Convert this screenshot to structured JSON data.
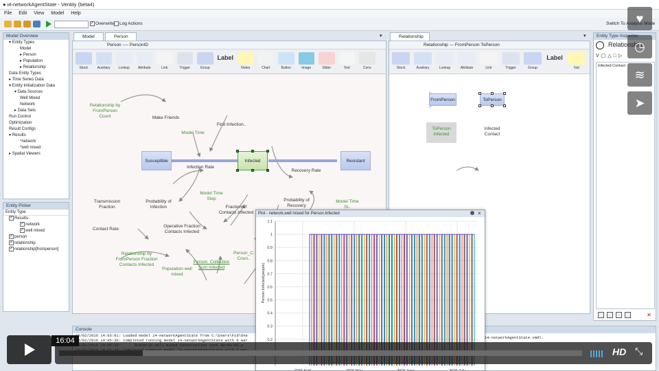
{
  "window": {
    "title": "● i4-networkAgentState - Ventity (beta4)",
    "switch_label": "Switch To Analysis Mode"
  },
  "menu": [
    "File",
    "Edit",
    "View",
    "Model",
    "Help"
  ],
  "toolbar": {
    "overwrite_label": "Overwrite",
    "log_label": "Log Actions",
    "overwrite_checked": true
  },
  "model_overview": {
    "title": "Model Overview",
    "items": [
      {
        "label": "Entity Types",
        "indent": 1,
        "toggle": "▾"
      },
      {
        "label": "Model",
        "indent": 3,
        "toggle": ""
      },
      {
        "label": "Person",
        "indent": 3,
        "toggle": "▸"
      },
      {
        "label": "Population",
        "indent": 3,
        "toggle": "▸"
      },
      {
        "label": "Relationship",
        "indent": 3,
        "toggle": "▸"
      },
      {
        "label": "Data Entity Types",
        "indent": 1,
        "toggle": ""
      },
      {
        "label": "Time Series Data",
        "indent": 1,
        "toggle": "▸"
      },
      {
        "label": "Entity Initialization Data",
        "indent": 1,
        "toggle": "▾"
      },
      {
        "label": "Data Sources",
        "indent": 2,
        "toggle": "▾"
      },
      {
        "label": "Well Mixed",
        "indent": 3,
        "toggle": ""
      },
      {
        "label": "Network",
        "indent": 3,
        "toggle": ""
      },
      {
        "label": "Data Sets",
        "indent": 2,
        "toggle": "▸"
      },
      {
        "label": "Run Control",
        "indent": 1,
        "toggle": ""
      },
      {
        "label": "Optimization",
        "indent": 1,
        "toggle": ""
      },
      {
        "label": "Result Configs",
        "indent": 1,
        "toggle": ""
      },
      {
        "label": "Results",
        "indent": 1,
        "toggle": "▾"
      },
      {
        "label": "*network",
        "indent": 3,
        "toggle": ""
      },
      {
        "label": "*well mixed",
        "indent": 3,
        "toggle": ""
      },
      {
        "label": "Spatial Viewers",
        "indent": 1,
        "toggle": "▸"
      }
    ]
  },
  "entity_picker": {
    "title": "Entity Picker",
    "header": "Entity Type",
    "items": [
      {
        "label": "Results",
        "indent": 1
      },
      {
        "label": "network",
        "indent": 3
      },
      {
        "label": "well mixed",
        "indent": 3
      },
      {
        "label": "person",
        "indent": 1
      },
      {
        "label": "relationship",
        "indent": 1
      },
      {
        "label": "relationship[fromperson]",
        "indent": 1
      }
    ]
  },
  "left_editor": {
    "tabs": [
      "Model",
      "Person"
    ],
    "breadcrumb": "Person ---- PersonID",
    "palette": [
      "Stock",
      "Auxiliary",
      "Lookup",
      "Attribute",
      "Link",
      "Trigger",
      "Group",
      "Label",
      "Notes",
      "Chart",
      "Button",
      "Image",
      "Slider",
      "Text",
      "Cons"
    ],
    "nodes": {
      "relationship_count": "Relationship by FromPerson Count",
      "make_friends": "Make Friends",
      "first_infection": "First Infection..",
      "model_time": "Model Time",
      "susceptible": "Susceptible",
      "infected": "Infected",
      "resistant": "Resistant",
      "infection_rate": "Infection Rate",
      "recovery_rate": "Recovery Rate",
      "model_time_step": "Model Time Step",
      "transmission_fraction": "Transmission Fraction",
      "probability_infection": "Probability of Infection",
      "fraction_contacts": "Fraction of Contacts Infected",
      "probability_recovery": "Probability of Recovery",
      "model_time_st": "Model Time St..",
      "contact_rate": "Contact Rate",
      "operative_fraction": "Operative Fraction Contacts Infected",
      "relationship_fraction": "Relationship by FromPerson Fraction Contacts Infected",
      "population_well_mixed": "Population well mixed",
      "person_collection": "Person_Collection Sum Infected",
      "person_c_count": "Person_C... Coun.."
    }
  },
  "right_editor": {
    "tab": "Relationship",
    "breadcrumb": "Relationship --- FromPerson ToPerson",
    "palette": [
      "Stock",
      "Auxiliary",
      "Lookup",
      "Attribute",
      "Link",
      "Trigger",
      "Group",
      "Label",
      "Not"
    ],
    "nodes": {
      "from_person": "FromPerson",
      "to_person": "ToPerson",
      "to_person_infected": "ToPerson Infected",
      "infected_contact": "Infected Contact"
    }
  },
  "inspector": {
    "title": "Entity Type Inspector",
    "name": "Relationship",
    "item": "Infected Contact"
  },
  "plot": {
    "title": "Plot - network,well mixed for Person.Infected",
    "y_label": "Person.Infected(people)",
    "y_ticks": [
      "1.1",
      "1",
      "0.9",
      "0.8",
      "0.7",
      "0.6",
      "0.5",
      "0.4",
      "0.3",
      "0.2",
      "0.1"
    ],
    "x_ticks": [
      "2015 April",
      "2015 May",
      "2015 June",
      "2015 July"
    ]
  },
  "console": {
    "title": "Console",
    "lines": [
      "10/02/2016 14:03:01: Loaded model i4-networkAgentState from C:\\Users\\Fid\\One",
      "10/02/2016 14:05:36: Completed running model i4-networkAgentState with 0 war",
      "10/02/2016 14:05:36:      Scenario well mixed construction took 00:00:00.a",
      "10/02/2016 14:05:36: Completed running model i4-networkAgentState with 0 war",
      "10/02/2016 14:05:38:      Scenario network construction took 00:00:00.0..."
    ],
    "tail": "i4-networkAgentState.vmdl."
  },
  "video": {
    "time": "16:04",
    "progress": 0.16,
    "hd_label": "HD"
  },
  "side_buttons": [
    "heart-icon",
    "clock-icon",
    "layers-icon",
    "send-icon"
  ]
}
